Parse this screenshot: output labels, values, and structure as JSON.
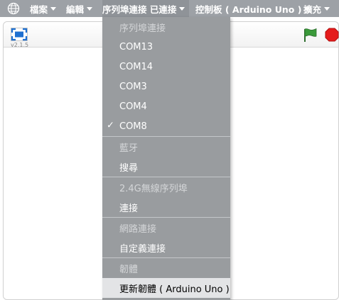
{
  "menubar": {
    "file": "檔案",
    "edit": "編輯",
    "serial_port": "序列埠連接 已連接",
    "board": "控制板 ( Arduino Uno )",
    "extensions": "擴充"
  },
  "stage": {
    "version": "v2.1.5"
  },
  "dropdown": {
    "serial_header": "序列埠連接",
    "ports": [
      "COM13",
      "COM14",
      "COM3",
      "COM4",
      "COM8"
    ],
    "selected_port": "COM8",
    "check_mark": "✓",
    "bluetooth_header": "藍牙",
    "search": "搜尋",
    "wireless_header": "2.4G無線序列埠",
    "connect": "連接",
    "network_header": "網路連接",
    "custom_connect": "自定義連接",
    "firmware_header": "韌體",
    "update_firmware": "更新韌體 ( Arduino Uno )"
  },
  "colors": {
    "menubar_bg": "#9da1a6",
    "dropdown_bg": "#999c9f",
    "flag_green": "#3a9a3a",
    "stop_red": "#e51b1b",
    "fullscreen_blue": "#1e6fd0"
  }
}
